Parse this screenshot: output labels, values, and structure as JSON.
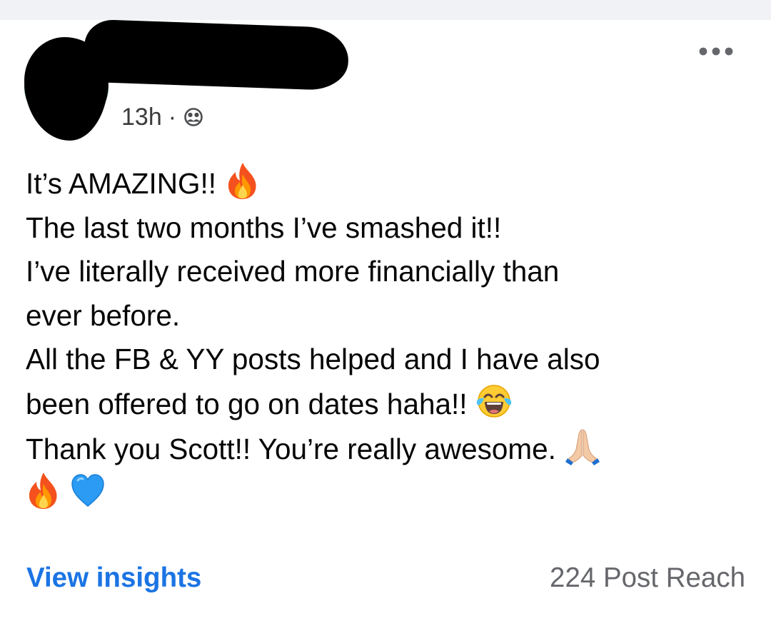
{
  "post": {
    "time": "13h",
    "separator": "·",
    "audience_icon": "friends-icon",
    "more_icon": "more-horizontal-icon",
    "lines": [
      "It’s AMAZING!!",
      "The last two months I’ve smashed it!!",
      "I’ve literally received  more financially than",
      "ever before.",
      "All the FB & YY posts helped and I have also",
      "been offered to go on dates haha!!",
      "Thank you Scott!! You’re really awesome."
    ],
    "emojis": {
      "line_1": "fire-emoji",
      "line_6": "tears-of-joy-emoji",
      "line_7": "folded-hands-emoji",
      "final_row": [
        "fire-emoji",
        "blue-heart-emoji"
      ]
    }
  },
  "footer": {
    "insights_label": "View insights",
    "reach_label": "224 Post Reach"
  },
  "colors": {
    "link": "#1b74e4",
    "secondary_text": "#65676b",
    "body_text": "#050505"
  }
}
